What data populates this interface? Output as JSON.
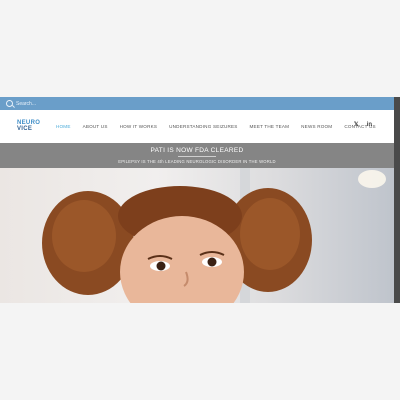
{
  "search": {
    "placeholder": "Search..."
  },
  "logo": {
    "line1": "NEURO",
    "line2": "VICE"
  },
  "nav": {
    "items": [
      {
        "label": "HOME",
        "active": true
      },
      {
        "label": "ABOUT US"
      },
      {
        "label": "HOW IT WORKS"
      },
      {
        "label": "UNDERSTANDING SEIZURES"
      },
      {
        "label": "MEET THE TEAM"
      },
      {
        "label": "NEWS ROOM"
      },
      {
        "label": "CONTACT US"
      }
    ]
  },
  "social": {
    "twitter": "𝕏",
    "linkedin": "in"
  },
  "banner": {
    "headline": "PATI IS NOW FDA CLEARED",
    "subline": "EPILEPSY IS THE 4th LEADING NEUROLOGIC DISORDER IN THE WORLD"
  },
  "colors": {
    "search_bar": "#6a9ec9",
    "accent": "#46a9d8",
    "banner": "#858585",
    "logo": "#3f8ec8"
  },
  "hero": {
    "image": "smiling child with curly hair"
  }
}
